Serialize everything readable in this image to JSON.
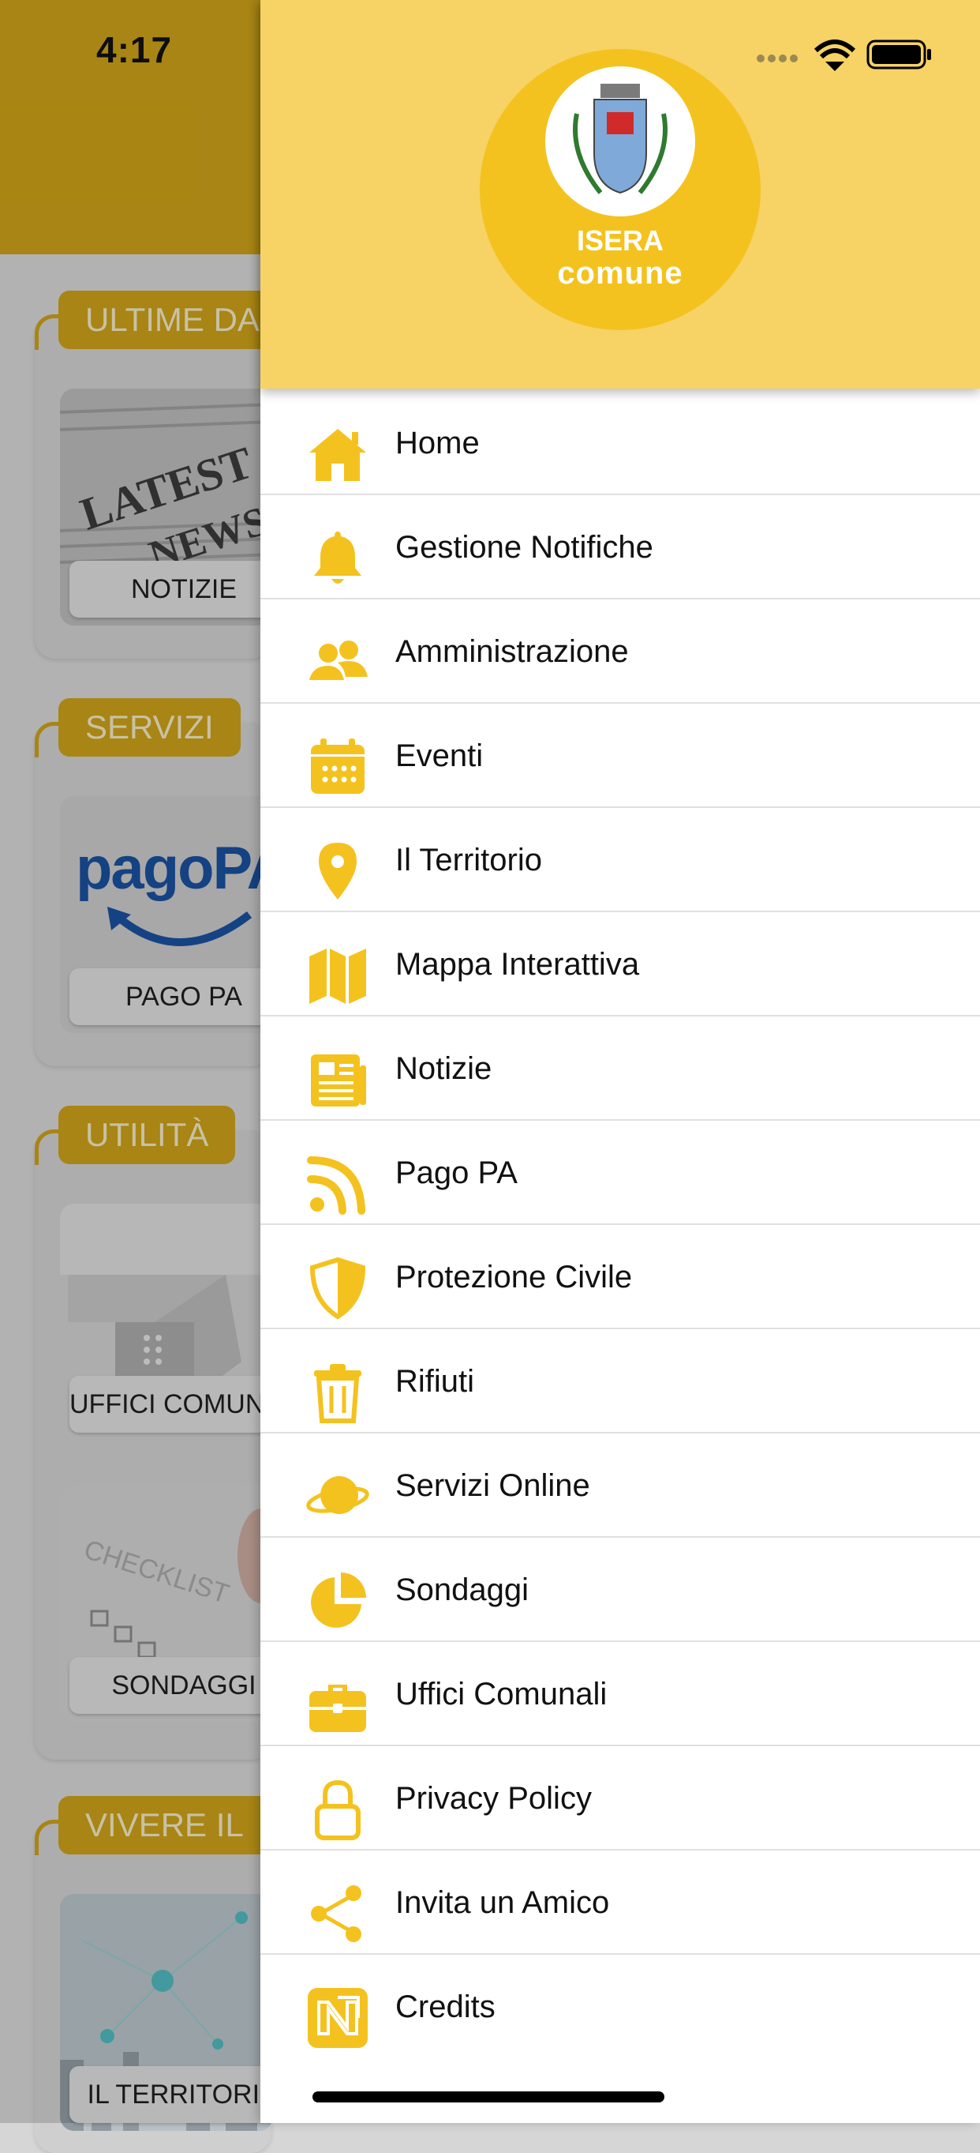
{
  "status_bar": {
    "time": "4:17"
  },
  "background": {
    "sections": [
      {
        "label": "ULTIME DA",
        "cards": [
          "NOTIZIE"
        ]
      },
      {
        "label": "SERVIZI",
        "cards": [
          "PAGO PA"
        ],
        "card_logo_text": "pagoPA"
      },
      {
        "label": "UTILITÀ",
        "cards": [
          "UFFICI COMUNALI",
          "SONDAGGI"
        ]
      },
      {
        "label": "VIVERE IL",
        "cards": [
          "IL TERRITORIO"
        ]
      }
    ]
  },
  "drawer": {
    "logo": {
      "line1": "ISERA",
      "line2": "comune"
    },
    "items": [
      {
        "label": "Home",
        "icon": "home-icon"
      },
      {
        "label": "Gestione Notifiche",
        "icon": "bell-icon"
      },
      {
        "label": "Amministrazione",
        "icon": "users-icon"
      },
      {
        "label": "Eventi",
        "icon": "calendar-icon"
      },
      {
        "label": "Il Territorio",
        "icon": "map-pin-icon"
      },
      {
        "label": "Mappa Interattiva",
        "icon": "map-icon"
      },
      {
        "label": "Notizie",
        "icon": "newspaper-icon"
      },
      {
        "label": "Pago PA",
        "icon": "rss-icon"
      },
      {
        "label": "Protezione Civile",
        "icon": "shield-icon"
      },
      {
        "label": "Rifiuti",
        "icon": "trash-icon"
      },
      {
        "label": "Servizi Online",
        "icon": "globe-ring-icon"
      },
      {
        "label": "Sondaggi",
        "icon": "pie-chart-icon"
      },
      {
        "label": "Uffici Comunali",
        "icon": "briefcase-icon"
      },
      {
        "label": "Privacy Policy",
        "icon": "lock-icon"
      },
      {
        "label": "Invita un Amico",
        "icon": "share-icon"
      },
      {
        "label": "Credits",
        "icon": "credits-icon"
      }
    ]
  },
  "colors": {
    "accent": "#f4c21f",
    "header_bg": "#f7d265",
    "bg_header": "#c99f18"
  }
}
